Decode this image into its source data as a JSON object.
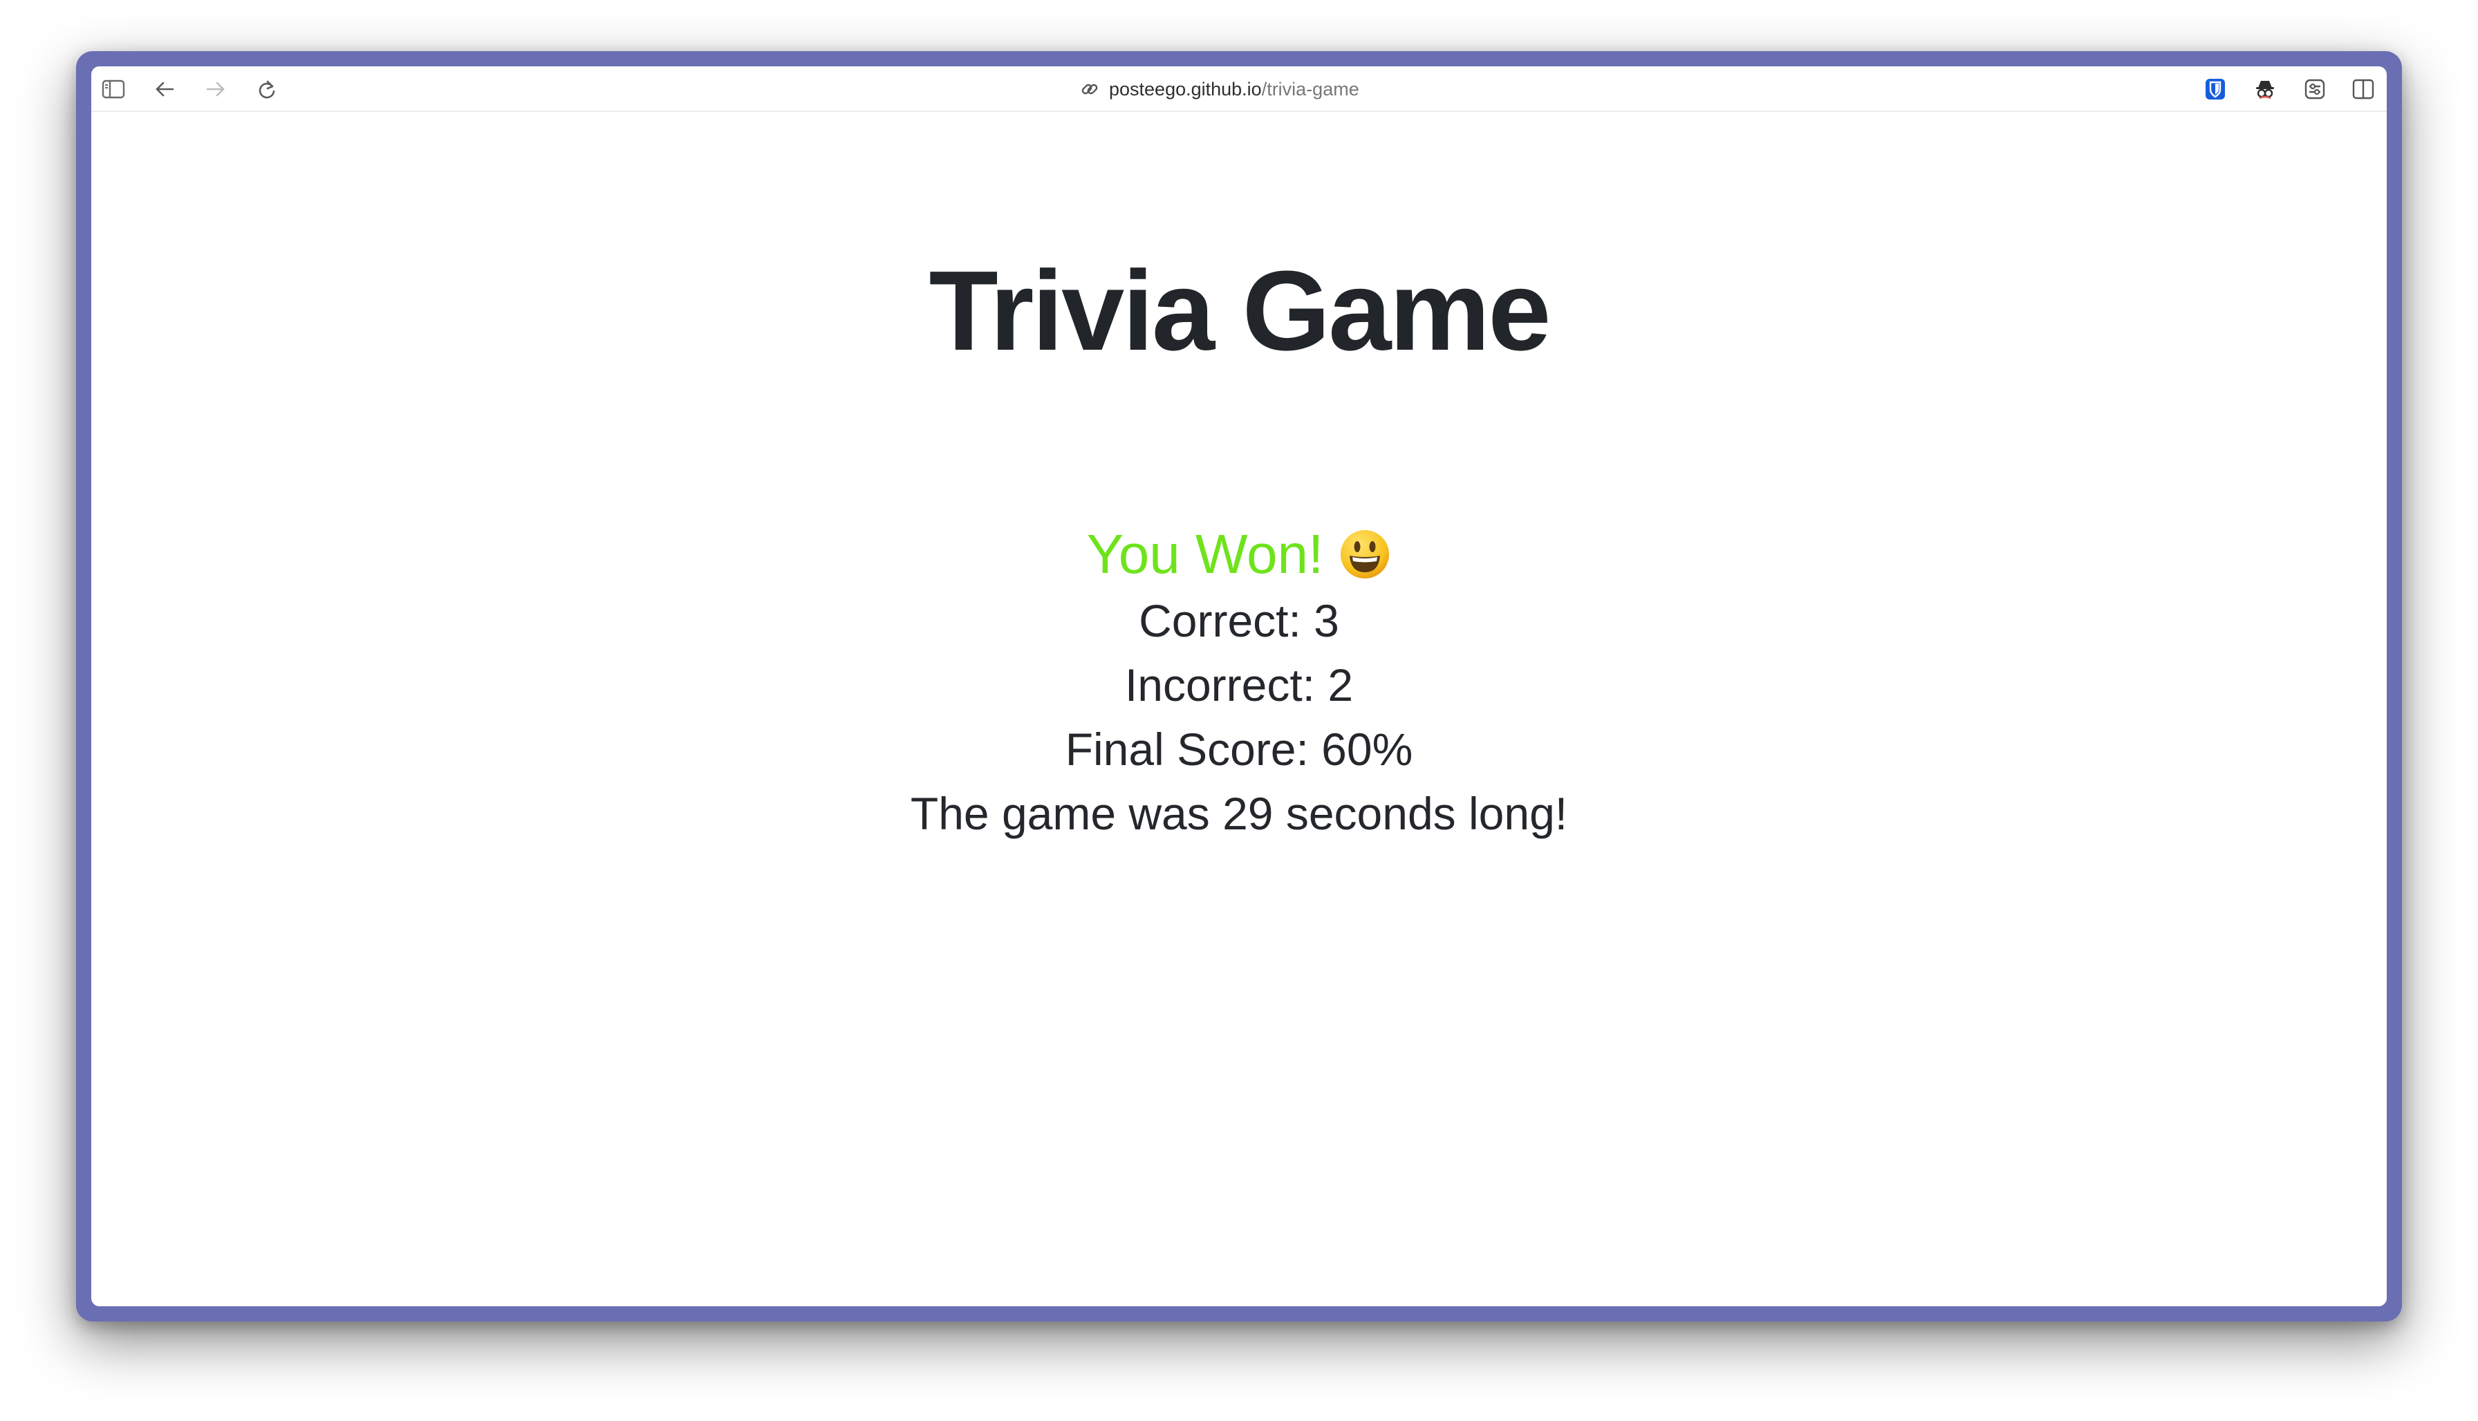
{
  "browser": {
    "url_host": "posteego.github.io",
    "url_path": "/trivia-game",
    "icons": {
      "sidebar": "sidebar-icon",
      "back": "arrow-left-icon",
      "forward": "arrow-right-icon",
      "reload": "reload-icon",
      "link": "link-icon",
      "extension_1": "bitwarden-icon",
      "extension_2": "incognito-icon",
      "extension_3": "extension-icon",
      "split_view": "split-view-icon"
    }
  },
  "page": {
    "title": "Trivia Game",
    "result": {
      "message": "You Won!",
      "emoji_icon": "smiley-icon",
      "message_color": "#6ee31b",
      "correct": "Correct: 3",
      "incorrect": "Incorrect: 2",
      "final_score": "Final Score: 60%",
      "duration": "The game was 29 seconds long!"
    }
  },
  "colors": {
    "window_frame": "#6a6eb2",
    "text": "#22262b",
    "bitwarden": "#175ddc"
  }
}
